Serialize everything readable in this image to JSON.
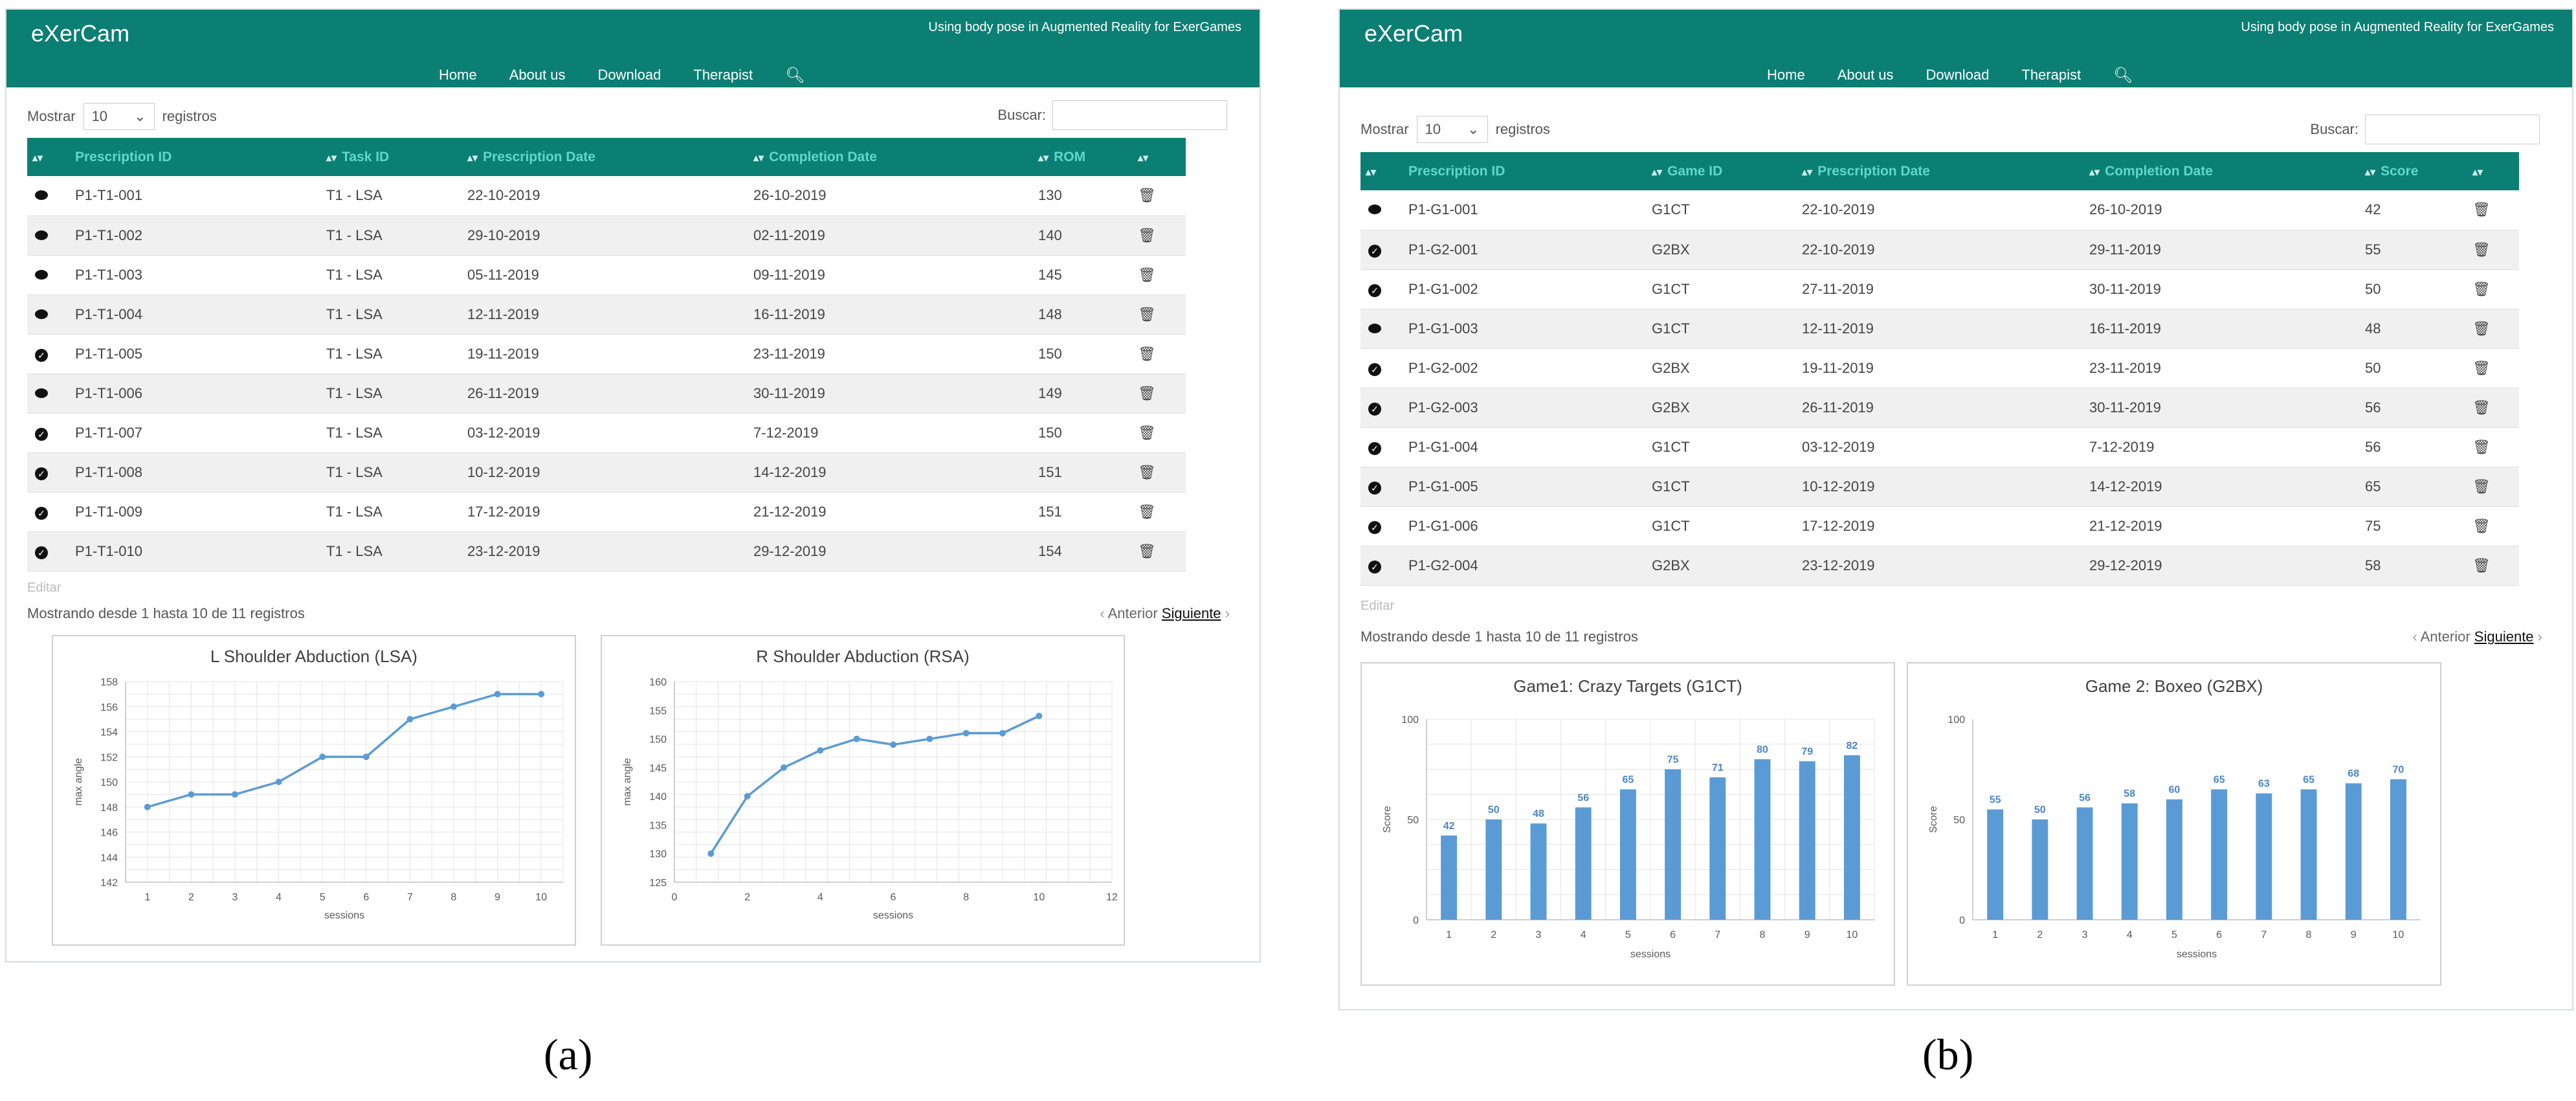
{
  "app": {
    "title": "eXerCam",
    "tagline": "Using body pose in Augmented Reality for ExerGames"
  },
  "nav": {
    "home": "Home",
    "about": "About us",
    "download": "Download",
    "therapist": "Therapist",
    "search_icon": "magnifier"
  },
  "controls": {
    "show": "Mostrar",
    "count": "10",
    "records": "registros",
    "search": "Buscar:"
  },
  "colors": {
    "header": "#0b7f73",
    "header_text": "#5ed8cb",
    "series": "#5b9bd5"
  },
  "panel_a": {
    "columns": [
      "Prescription ID",
      "Task ID",
      "Prescription Date",
      "Completion Date",
      "ROM"
    ],
    "rows": [
      {
        "status": "pending",
        "id": "P1-T1-001",
        "task": "T1 - LSA",
        "pdate": "22-10-2019",
        "cdate": "26-10-2019",
        "val": "130"
      },
      {
        "status": "pending",
        "id": "P1-T1-002",
        "task": "T1 - LSA",
        "pdate": "29-10-2019",
        "cdate": "02-11-2019",
        "val": "140"
      },
      {
        "status": "pending",
        "id": "P1-T1-003",
        "task": "T1 - LSA",
        "pdate": "05-11-2019",
        "cdate": "09-11-2019",
        "val": "145"
      },
      {
        "status": "pending",
        "id": "P1-T1-004",
        "task": "T1 - LSA",
        "pdate": "12-11-2019",
        "cdate": "16-11-2019",
        "val": "148"
      },
      {
        "status": "done",
        "id": "P1-T1-005",
        "task": "T1 - LSA",
        "pdate": "19-11-2019",
        "cdate": "23-11-2019",
        "val": "150"
      },
      {
        "status": "pending",
        "id": "P1-T1-006",
        "task": "T1 - LSA",
        "pdate": "26-11-2019",
        "cdate": "30-11-2019",
        "val": "149"
      },
      {
        "status": "done",
        "id": "P1-T1-007",
        "task": "T1 - LSA",
        "pdate": "03-12-2019",
        "cdate": "7-12-2019",
        "val": "150"
      },
      {
        "status": "done",
        "id": "P1-T1-008",
        "task": "T1 - LSA",
        "pdate": "10-12-2019",
        "cdate": "14-12-2019",
        "val": "151"
      },
      {
        "status": "done",
        "id": "P1-T1-009",
        "task": "T1 - LSA",
        "pdate": "17-12-2019",
        "cdate": "21-12-2019",
        "val": "151"
      },
      {
        "status": "done",
        "id": "P1-T1-010",
        "task": "T1 - LSA",
        "pdate": "23-12-2019",
        "cdate": "29-12-2019",
        "val": "154"
      }
    ],
    "editar": "Editar",
    "info": "Mostrando desde 1 hasta 10 de 11 registros",
    "prev": "Anterior",
    "next": "Siguiente",
    "caption": "(a)"
  },
  "panel_b": {
    "columns": [
      "Prescription ID",
      "Game ID",
      "Prescription Date",
      "Completion Date",
      "Score"
    ],
    "rows": [
      {
        "status": "pending",
        "id": "P1-G1-001",
        "task": "G1CT",
        "pdate": "22-10-2019",
        "cdate": "26-10-2019",
        "val": "42"
      },
      {
        "status": "done",
        "id": "P1-G2-001",
        "task": "G2BX",
        "pdate": "22-10-2019",
        "cdate": "29-11-2019",
        "val": "55"
      },
      {
        "status": "done",
        "id": "P1-G1-002",
        "task": "G1CT",
        "pdate": "27-11-2019",
        "cdate": "30-11-2019",
        "val": "50"
      },
      {
        "status": "pending",
        "id": "P1-G1-003",
        "task": "G1CT",
        "pdate": "12-11-2019",
        "cdate": "16-11-2019",
        "val": "48"
      },
      {
        "status": "done",
        "id": "P1-G2-002",
        "task": "G2BX",
        "pdate": "19-11-2019",
        "cdate": "23-11-2019",
        "val": "50"
      },
      {
        "status": "done",
        "id": "P1-G2-003",
        "task": "G2BX",
        "pdate": "26-11-2019",
        "cdate": "30-11-2019",
        "val": "56"
      },
      {
        "status": "done",
        "id": "P1-G1-004",
        "task": "G1CT",
        "pdate": "03-12-2019",
        "cdate": "7-12-2019",
        "val": "56"
      },
      {
        "status": "done",
        "id": "P1-G1-005",
        "task": "G1CT",
        "pdate": "10-12-2019",
        "cdate": "14-12-2019",
        "val": "65"
      },
      {
        "status": "done",
        "id": "P1-G1-006",
        "task": "G1CT",
        "pdate": "17-12-2019",
        "cdate": "21-12-2019",
        "val": "75"
      },
      {
        "status": "done",
        "id": "P1-G2-004",
        "task": "G2BX",
        "pdate": "23-12-2019",
        "cdate": "29-12-2019",
        "val": "58"
      }
    ],
    "editar": "Editar",
    "info": "Mostrando desde 1 hasta 10 de 11 registros",
    "prev": "Anterior",
    "next": "Siguiente",
    "caption": "(b)"
  },
  "chart_data": [
    {
      "type": "line",
      "title": "L Shoulder Abduction (LSA)",
      "xlabel": "sessions",
      "ylabel": "max angle",
      "x": [
        1,
        2,
        3,
        4,
        5,
        6,
        7,
        8,
        9,
        10
      ],
      "series": [
        {
          "values": [
            148,
            149,
            149,
            150,
            152,
            152,
            155,
            156,
            157,
            157
          ]
        }
      ],
      "xlim": [
        0.5,
        10.5
      ],
      "ylim": [
        142,
        158
      ],
      "xticks": [
        1,
        2,
        3,
        4,
        5,
        6,
        7,
        8,
        9,
        10
      ],
      "yticks": [
        142,
        144,
        146,
        148,
        150,
        152,
        154,
        156,
        158
      ],
      "grid": true
    },
    {
      "type": "line",
      "title": "R Shoulder Abduction (RSA)",
      "xlabel": "sessions",
      "ylabel": "max angle",
      "x": [
        1,
        2,
        3,
        4,
        5,
        6,
        7,
        8,
        9,
        10
      ],
      "series": [
        {
          "values": [
            130,
            140,
            145,
            148,
            150,
            149,
            150,
            151,
            151,
            154
          ]
        }
      ],
      "xlim": [
        0,
        12
      ],
      "ylim": [
        125,
        160
      ],
      "xticks": [
        0,
        2,
        4,
        6,
        8,
        10,
        12
      ],
      "yticks": [
        125,
        130,
        135,
        140,
        145,
        150,
        155,
        160
      ],
      "grid": true
    },
    {
      "type": "bar",
      "title": "Game1: Crazy Targets (G1CT)",
      "xlabel": "sessions",
      "ylabel": "Score",
      "categories": [
        "1",
        "2",
        "3",
        "4",
        "5",
        "6",
        "7",
        "8",
        "9",
        "10"
      ],
      "values": [
        42,
        50,
        48,
        56,
        65,
        75,
        71,
        80,
        79,
        82
      ],
      "ylim": [
        0,
        100
      ],
      "yticks": [
        0,
        50,
        100
      ],
      "grid": true
    },
    {
      "type": "bar",
      "title": "Game 2: Boxeo (G2BX)",
      "xlabel": "sessions",
      "ylabel": "Score",
      "categories": [
        "1",
        "2",
        "3",
        "4",
        "5",
        "6",
        "7",
        "8",
        "9",
        "10"
      ],
      "values": [
        55,
        50,
        56,
        58,
        60,
        65,
        63,
        65,
        68,
        70
      ],
      "ylim": [
        0,
        100
      ],
      "yticks": [
        0,
        50,
        100
      ],
      "grid": false
    }
  ]
}
